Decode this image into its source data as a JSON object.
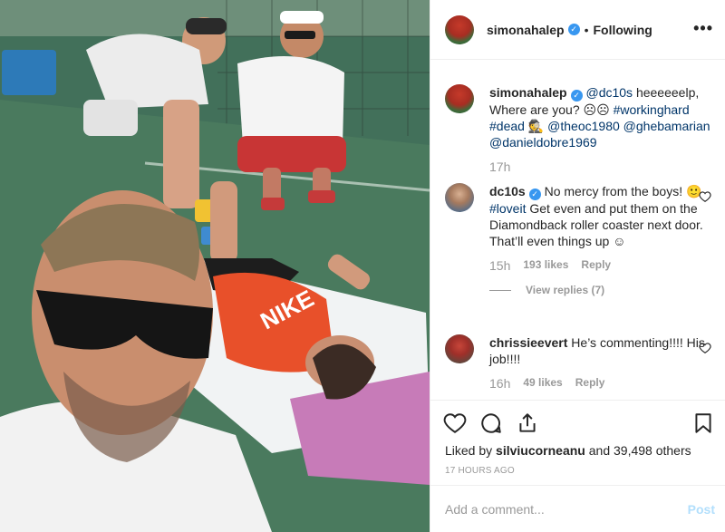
{
  "header": {
    "username": "simonahalep",
    "dot": "•",
    "follow_state": "Following",
    "more_glyph": "•••"
  },
  "comments": [
    {
      "username": "simonahalep",
      "verified": true,
      "text_parts": [
        "@dc10s",
        " heeeeeelp, Where are you? ☹☹ ",
        "#workinghard",
        " ",
        "#dead",
        " 🕵 ",
        "@theoc1980",
        " ",
        "@ghebamarian",
        " ",
        "@danieldobre1969"
      ],
      "age": "17h"
    },
    {
      "username": "dc10s",
      "verified": true,
      "text_parts": [
        "No mercy from the boys! 🙂 ",
        "#loveit",
        " Get even and put them on the Diamondback roller coaster next door. That’ll even things up ☺"
      ],
      "age": "15h",
      "likes": "193 likes",
      "reply": "Reply",
      "view_replies": "View replies (7)"
    },
    {
      "username": "chrissieevert",
      "verified": false,
      "text": "He’s commenting!!!! His job!!!!",
      "age": "16h",
      "likes": "49 likes",
      "reply": "Reply"
    }
  ],
  "actions": {
    "liked_by_prefix": "Liked by ",
    "liked_by_user": "silviucorneanu",
    "liked_by_suffix": " and 39,498 others",
    "time_ago": "17 HOURS AGO"
  },
  "composer": {
    "placeholder": "Add a comment...",
    "post_label": "Post"
  },
  "colors": {
    "link": "#003569",
    "verified": "#3897f0",
    "muted": "#999999",
    "post_disabled": "#b2dffc",
    "shirt_orange": "#e8502a",
    "court_green": "#3f6b51",
    "towel_pink": "#c77bb8"
  }
}
